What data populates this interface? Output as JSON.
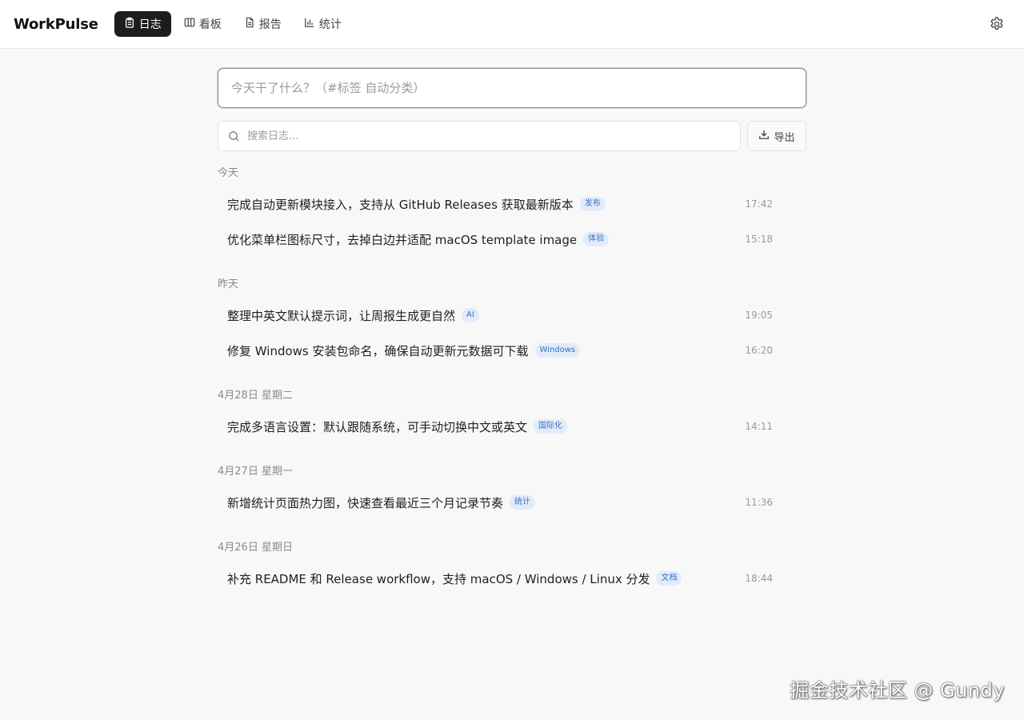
{
  "app": {
    "title": "WorkPulse"
  },
  "nav": {
    "items": [
      {
        "label": "日志",
        "icon": "clipboard-icon",
        "active": true
      },
      {
        "label": "看板",
        "icon": "board-icon",
        "active": false
      },
      {
        "label": "报告",
        "icon": "document-icon",
        "active": false
      },
      {
        "label": "统计",
        "icon": "bar-chart-icon",
        "active": false
      }
    ],
    "settings_icon": "gear-icon"
  },
  "compose": {
    "placeholder": "今天干了什么？（#标签 自动分类）",
    "value": ""
  },
  "search": {
    "placeholder": "搜索日志...",
    "value": "",
    "icon": "search-icon"
  },
  "export": {
    "label": "导出",
    "icon": "download-icon"
  },
  "groups": [
    {
      "label": "今天",
      "entries": [
        {
          "text": "完成自动更新模块接入，支持从 GitHub Releases 获取最新版本",
          "tag": "发布",
          "time": "17:42"
        },
        {
          "text": "优化菜单栏图标尺寸，去掉白边并适配 macOS template image",
          "tag": "体验",
          "time": "15:18"
        }
      ]
    },
    {
      "label": "昨天",
      "entries": [
        {
          "text": "整理中英文默认提示词，让周报生成更自然",
          "tag": "AI",
          "time": "19:05"
        },
        {
          "text": "修复 Windows 安装包命名，确保自动更新元数据可下载",
          "tag": "Windows",
          "time": "16:20"
        }
      ]
    },
    {
      "label": "4月28日 星期二",
      "entries": [
        {
          "text": "完成多语言设置：默认跟随系统，可手动切换中文或英文",
          "tag": "国际化",
          "time": "14:11"
        }
      ]
    },
    {
      "label": "4月27日 星期一",
      "entries": [
        {
          "text": "新增统计页面热力图，快速查看最近三个月记录节奏",
          "tag": "统计",
          "time": "11:36"
        }
      ]
    },
    {
      "label": "4月26日 星期日",
      "entries": [
        {
          "text": "补充 README 和 Release workflow，支持 macOS / Windows / Linux 分发",
          "tag": "文档",
          "time": "18:44"
        }
      ]
    }
  ],
  "watermark": "掘金技术社区 @ Gundy",
  "colors": {
    "accent": "#1d1d1f",
    "tag_bg": "#e1ecfb",
    "tag_text": "#3a6fc4"
  }
}
